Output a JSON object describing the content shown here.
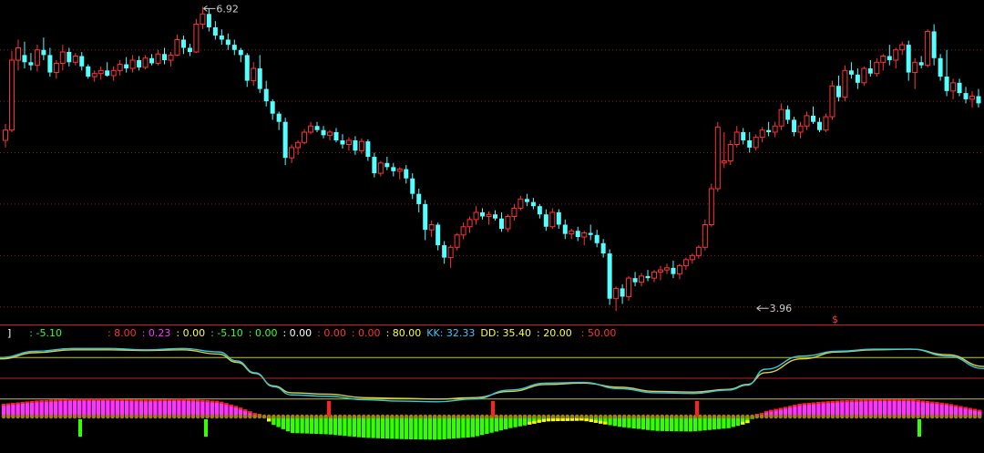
{
  "colors": {
    "background": "#000000",
    "up": "#ff3333",
    "down": "#54ffff",
    "grid": "#8b1a1a",
    "hline_yellow": "#c8c800",
    "hline_red": "#c81e1e",
    "line_cyan": "#38c8d8",
    "line_yellow": "#d8d050",
    "hist_green": "#33ff00",
    "hist_magenta": "#ff33ff",
    "hist_red": "#ff2020",
    "hist_yellow": "#ffff00"
  },
  "chart_data": [
    {
      "type": "candlestick",
      "annotations": [
        {
          "label": "6.92",
          "x_index": 31,
          "value": 6.92
        },
        {
          "label": "3.96",
          "x_index": 118,
          "value": 3.96
        }
      ],
      "ylim": [
        3.9,
        6.95
      ],
      "grid": "horizontal dotted",
      "candles": [
        [
          5.62,
          5.78,
          5.55,
          5.72
        ],
        [
          5.72,
          6.49,
          5.7,
          6.4
        ],
        [
          6.4,
          6.6,
          6.3,
          6.52
        ],
        [
          6.45,
          6.58,
          6.32,
          6.38
        ],
        [
          6.38,
          6.47,
          6.3,
          6.35
        ],
        [
          6.35,
          6.55,
          6.29,
          6.5
        ],
        [
          6.5,
          6.62,
          6.4,
          6.45
        ],
        [
          6.45,
          6.52,
          6.24,
          6.28
        ],
        [
          6.28,
          6.4,
          6.22,
          6.37
        ],
        [
          6.37,
          6.55,
          6.3,
          6.48
        ],
        [
          6.48,
          6.52,
          6.34,
          6.38
        ],
        [
          6.38,
          6.47,
          6.35,
          6.44
        ],
        [
          6.44,
          6.48,
          6.3,
          6.34
        ],
        [
          6.34,
          6.36,
          6.22,
          6.24
        ],
        [
          6.24,
          6.3,
          6.19,
          6.27
        ],
        [
          6.27,
          6.34,
          6.21,
          6.3
        ],
        [
          6.3,
          6.38,
          6.24,
          6.25
        ],
        [
          6.25,
          6.34,
          6.2,
          6.3
        ],
        [
          6.3,
          6.4,
          6.25,
          6.36
        ],
        [
          6.36,
          6.43,
          6.28,
          6.32
        ],
        [
          6.32,
          6.45,
          6.28,
          6.4
        ],
        [
          6.4,
          6.44,
          6.3,
          6.33
        ],
        [
          6.33,
          6.45,
          6.31,
          6.42
        ],
        [
          6.42,
          6.46,
          6.35,
          6.37
        ],
        [
          6.37,
          6.5,
          6.35,
          6.46
        ],
        [
          6.46,
          6.52,
          6.36,
          6.4
        ],
        [
          6.4,
          6.48,
          6.34,
          6.45
        ],
        [
          6.45,
          6.65,
          6.44,
          6.6
        ],
        [
          6.6,
          6.64,
          6.46,
          6.52
        ],
        [
          6.52,
          6.56,
          6.44,
          6.48
        ],
        [
          6.48,
          6.8,
          6.47,
          6.75
        ],
        [
          6.75,
          6.92,
          6.7,
          6.85
        ],
        [
          6.85,
          6.9,
          6.68,
          6.72
        ],
        [
          6.72,
          6.78,
          6.6,
          6.64
        ],
        [
          6.64,
          6.7,
          6.55,
          6.6
        ],
        [
          6.6,
          6.66,
          6.5,
          6.55
        ],
        [
          6.55,
          6.6,
          6.45,
          6.5
        ],
        [
          6.5,
          6.52,
          6.38,
          6.45
        ],
        [
          6.45,
          6.47,
          6.14,
          6.2
        ],
        [
          6.2,
          6.38,
          6.15,
          6.32
        ],
        [
          6.32,
          6.45,
          6.08,
          6.12
        ],
        [
          6.12,
          6.2,
          5.95,
          6.0
        ],
        [
          6.0,
          6.02,
          5.82,
          5.88
        ],
        [
          5.88,
          5.9,
          5.72,
          5.8
        ],
        [
          5.8,
          5.84,
          5.38,
          5.45
        ],
        [
          5.45,
          5.58,
          5.4,
          5.55
        ],
        [
          5.55,
          5.62,
          5.48,
          5.6
        ],
        [
          5.6,
          5.73,
          5.58,
          5.7
        ],
        [
          5.7,
          5.8,
          5.68,
          5.76
        ],
        [
          5.76,
          5.8,
          5.7,
          5.72
        ],
        [
          5.72,
          5.76,
          5.64,
          5.67
        ],
        [
          5.67,
          5.72,
          5.62,
          5.7
        ],
        [
          5.7,
          5.74,
          5.6,
          5.62
        ],
        [
          5.62,
          5.68,
          5.54,
          5.58
        ],
        [
          5.58,
          5.65,
          5.52,
          5.62
        ],
        [
          5.62,
          5.66,
          5.48,
          5.52
        ],
        [
          5.52,
          5.64,
          5.49,
          5.61
        ],
        [
          5.61,
          5.63,
          5.42,
          5.46
        ],
        [
          5.46,
          5.5,
          5.26,
          5.3
        ],
        [
          5.3,
          5.42,
          5.27,
          5.4
        ],
        [
          5.4,
          5.46,
          5.33,
          5.36
        ],
        [
          5.36,
          5.4,
          5.27,
          5.32
        ],
        [
          5.32,
          5.36,
          5.24,
          5.34
        ],
        [
          5.34,
          5.38,
          5.2,
          5.25
        ],
        [
          5.25,
          5.3,
          5.05,
          5.1
        ],
        [
          5.1,
          5.15,
          4.92,
          5.0
        ],
        [
          5.0,
          5.04,
          4.65,
          4.75
        ],
        [
          4.75,
          4.84,
          4.68,
          4.8
        ],
        [
          4.8,
          4.82,
          4.55,
          4.6
        ],
        [
          4.6,
          4.64,
          4.42,
          4.48
        ],
        [
          4.48,
          4.6,
          4.38,
          4.58
        ],
        [
          4.58,
          4.72,
          4.55,
          4.7
        ],
        [
          4.7,
          4.82,
          4.66,
          4.78
        ],
        [
          4.78,
          4.88,
          4.72,
          4.85
        ],
        [
          4.85,
          4.98,
          4.8,
          4.92
        ],
        [
          4.92,
          4.96,
          4.85,
          4.88
        ],
        [
          4.88,
          4.93,
          4.8,
          4.9
        ],
        [
          4.9,
          4.94,
          4.84,
          4.86
        ],
        [
          4.86,
          4.92,
          4.73,
          4.76
        ],
        [
          4.76,
          4.9,
          4.73,
          4.88
        ],
        [
          4.88,
          5.0,
          4.84,
          4.96
        ],
        [
          4.96,
          5.08,
          4.94,
          5.05
        ],
        [
          5.05,
          5.1,
          4.98,
          5.02
        ],
        [
          5.02,
          5.06,
          4.95,
          4.98
        ],
        [
          4.98,
          5.0,
          4.86,
          4.9
        ],
        [
          4.9,
          4.95,
          4.74,
          4.78
        ],
        [
          4.78,
          4.96,
          4.76,
          4.92
        ],
        [
          4.92,
          4.95,
          4.76,
          4.8
        ],
        [
          4.8,
          4.85,
          4.66,
          4.71
        ],
        [
          4.71,
          4.76,
          4.66,
          4.74
        ],
        [
          4.74,
          4.78,
          4.64,
          4.68
        ],
        [
          4.68,
          4.74,
          4.6,
          4.72
        ],
        [
          4.72,
          4.8,
          4.65,
          4.7
        ],
        [
          4.7,
          4.75,
          4.58,
          4.62
        ],
        [
          4.62,
          4.66,
          4.48,
          4.52
        ],
        [
          4.52,
          4.56,
          4.02,
          4.08
        ],
        [
          4.08,
          4.2,
          3.96,
          4.18
        ],
        [
          4.18,
          4.22,
          4.03,
          4.1
        ],
        [
          4.1,
          4.3,
          4.06,
          4.28
        ],
        [
          4.28,
          4.34,
          4.2,
          4.24
        ],
        [
          4.24,
          4.33,
          4.2,
          4.3
        ],
        [
          4.3,
          4.36,
          4.25,
          4.28
        ],
        [
          4.28,
          4.36,
          4.24,
          4.34
        ],
        [
          4.34,
          4.4,
          4.26,
          4.36
        ],
        [
          4.36,
          4.42,
          4.32,
          4.38
        ],
        [
          4.38,
          4.45,
          4.28,
          4.32
        ],
        [
          4.32,
          4.42,
          4.27,
          4.4
        ],
        [
          4.4,
          4.48,
          4.36,
          4.46
        ],
        [
          4.46,
          4.52,
          4.42,
          4.5
        ],
        [
          4.5,
          4.6,
          4.47,
          4.58
        ],
        [
          4.58,
          4.85,
          4.55,
          4.8
        ],
        [
          4.8,
          5.2,
          4.78,
          5.15
        ],
        [
          5.15,
          5.8,
          5.12,
          5.75
        ],
        [
          5.4,
          5.7,
          5.35,
          5.42
        ],
        [
          5.42,
          5.62,
          5.38,
          5.58
        ],
        [
          5.58,
          5.76,
          5.55,
          5.7
        ],
        [
          5.7,
          5.74,
          5.58,
          5.62
        ],
        [
          5.62,
          5.7,
          5.5,
          5.55
        ],
        [
          5.55,
          5.68,
          5.52,
          5.65
        ],
        [
          5.65,
          5.75,
          5.6,
          5.72
        ],
        [
          5.72,
          5.8,
          5.66,
          5.7
        ],
        [
          5.7,
          5.8,
          5.65,
          5.76
        ],
        [
          5.76,
          5.98,
          5.72,
          5.92
        ],
        [
          5.92,
          5.96,
          5.78,
          5.82
        ],
        [
          5.82,
          5.85,
          5.66,
          5.7
        ],
        [
          5.7,
          5.8,
          5.64,
          5.76
        ],
        [
          5.76,
          5.9,
          5.72,
          5.86
        ],
        [
          5.86,
          5.95,
          5.78,
          5.8
        ],
        [
          5.8,
          5.84,
          5.7,
          5.72
        ],
        [
          5.72,
          5.88,
          5.7,
          5.85
        ],
        [
          5.85,
          6.2,
          5.82,
          6.15
        ],
        [
          6.15,
          6.25,
          6.0,
          6.04
        ],
        [
          6.04,
          6.35,
          6.0,
          6.3
        ],
        [
          6.3,
          6.38,
          6.22,
          6.26
        ],
        [
          6.26,
          6.32,
          6.12,
          6.18
        ],
        [
          6.18,
          6.34,
          6.15,
          6.32
        ],
        [
          6.32,
          6.4,
          6.24,
          6.27
        ],
        [
          6.27,
          6.42,
          6.24,
          6.38
        ],
        [
          6.38,
          6.46,
          6.3,
          6.44
        ],
        [
          6.44,
          6.55,
          6.35,
          6.4
        ],
        [
          6.4,
          6.52,
          6.32,
          6.5
        ],
        [
          6.5,
          6.58,
          6.45,
          6.55
        ],
        [
          6.55,
          6.59,
          6.2,
          6.28
        ],
        [
          6.28,
          6.42,
          6.12,
          6.38
        ],
        [
          6.38,
          6.44,
          6.32,
          6.35
        ],
        [
          6.35,
          6.7,
          6.33,
          6.68
        ],
        [
          6.68,
          6.75,
          6.35,
          6.42
        ],
        [
          6.42,
          6.46,
          6.2,
          6.24
        ],
        [
          6.24,
          6.5,
          6.05,
          6.1
        ],
        [
          6.1,
          6.22,
          6.02,
          6.18
        ],
        [
          6.18,
          6.22,
          6.05,
          6.08
        ],
        [
          6.08,
          6.14,
          5.98,
          6.02
        ],
        [
          6.02,
          6.1,
          5.94,
          6.05
        ],
        [
          6.05,
          6.12,
          5.94,
          5.98
        ]
      ]
    },
    {
      "type": "line",
      "legend_items": [
        {
          "text": "]",
          "color": "#ffffff"
        },
        {
          "text": ": -5.10",
          "color": "#33ff33"
        },
        {
          "text": ": 8.00",
          "color": "#ff3333"
        },
        {
          "text": ": 0.23",
          "color": "#ff33ff"
        },
        {
          "text": ": 0.00",
          "color": "#ffff33"
        },
        {
          "text": ": -5.10",
          "color": "#33ff33"
        },
        {
          "text": ": 0.00",
          "color": "#33ff33"
        },
        {
          "text": ": 0.00",
          "color": "#ffffff"
        },
        {
          "text": ": 0.00",
          "color": "#ff3333"
        },
        {
          "text": ": 0.00",
          "color": "#ff3333"
        },
        {
          "text": ": 80.00",
          "color": "#ffff33"
        },
        {
          "text": "KK: 32.33",
          "color": "#38c8ff"
        },
        {
          "text": "DD: 35.40",
          "color": "#ffff33"
        },
        {
          "text": ": 20.00",
          "color": "#ffff33"
        },
        {
          "text": ": 50.00",
          "color": "#ff3333"
        }
      ],
      "hlines": [
        {
          "value": 80,
          "color": "yellow"
        },
        {
          "value": 50,
          "color": "red"
        },
        {
          "value": 20,
          "color": "yellow"
        }
      ],
      "ylim": [
        0,
        100
      ],
      "x": [
        0,
        40,
        80,
        120,
        160,
        200,
        240,
        260,
        280,
        300,
        320,
        360,
        400,
        440,
        480,
        520,
        560,
        600,
        640,
        680,
        720,
        760,
        800,
        820,
        840,
        880,
        920,
        960,
        1000,
        1040,
        1080
      ],
      "series": [
        {
          "name": "KK",
          "color": "cyan",
          "values": [
            80,
            89,
            93,
            93,
            91,
            93,
            88,
            75,
            58,
            38,
            26,
            24,
            19,
            17,
            16,
            20,
            33,
            43,
            44,
            35,
            29,
            28,
            33,
            40,
            63,
            82,
            89,
            92,
            92,
            82,
            64
          ]
        },
        {
          "name": "DD",
          "color": "yellow",
          "values": [
            78,
            87,
            91,
            91,
            90,
            91,
            85,
            73,
            57,
            39,
            29,
            27,
            22,
            21,
            20,
            22,
            31,
            41,
            43,
            37,
            31,
            30,
            34,
            41,
            58,
            78,
            88,
            91,
            92,
            84,
            67
          ]
        }
      ]
    }
  ]
}
